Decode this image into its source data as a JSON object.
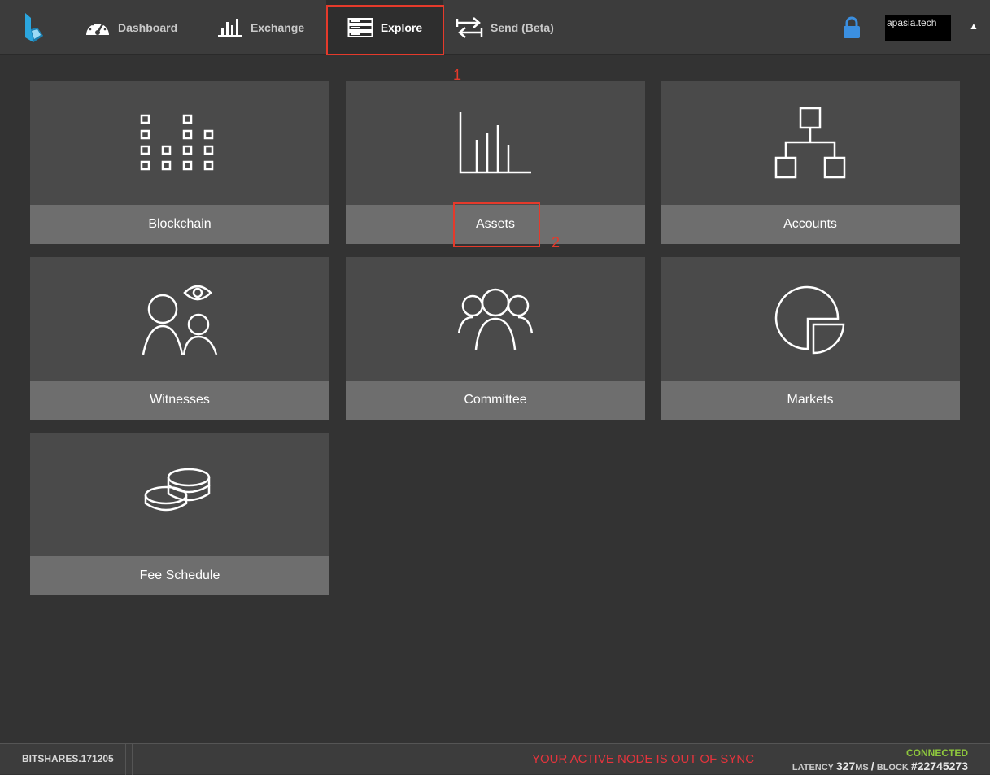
{
  "nav": {
    "items": [
      {
        "label": "Dashboard",
        "icon": "dashboard-gauge-icon"
      },
      {
        "label": "Exchange",
        "icon": "exchange-bars-icon"
      },
      {
        "label": "Explore",
        "icon": "explore-server-icon",
        "active": true
      },
      {
        "label": "Send (Beta)",
        "icon": "send-arrows-icon"
      }
    ],
    "account_name": "apasia.tech"
  },
  "annotations": {
    "marker_1": "1",
    "marker_2": "2"
  },
  "tiles": [
    {
      "label": "Blockchain",
      "icon": "blockchain-blocks-icon"
    },
    {
      "label": "Assets",
      "icon": "assets-bar-chart-icon"
    },
    {
      "label": "Accounts",
      "icon": "accounts-hierarchy-icon"
    },
    {
      "label": "Witnesses",
      "icon": "witnesses-eye-icon"
    },
    {
      "label": "Committee",
      "icon": "committee-group-icon"
    },
    {
      "label": "Markets",
      "icon": "markets-pie-icon"
    },
    {
      "label": "Fee Schedule",
      "icon": "fee-coins-icon"
    }
  ],
  "footer": {
    "version": "BITSHARES.171205",
    "sync_warning": "YOUR ACTIVE NODE IS OUT OF SYNC",
    "connection": "CONNECTED",
    "latency_label": "LATENCY",
    "latency_value": "327",
    "latency_unit": "MS",
    "separator": "/",
    "block_label": "BLOCK",
    "block_value": "#22745273"
  },
  "colors": {
    "background": "#333333",
    "topbar": "#3c3c3c",
    "tile": "#4a4a4a",
    "tile_label": "#6e6e6e",
    "annotation": "#e53a2b",
    "sync_warning": "#e5343c",
    "connected": "#8ec73c",
    "logo": "#2ba6de",
    "lock": "#3b8fe0"
  }
}
